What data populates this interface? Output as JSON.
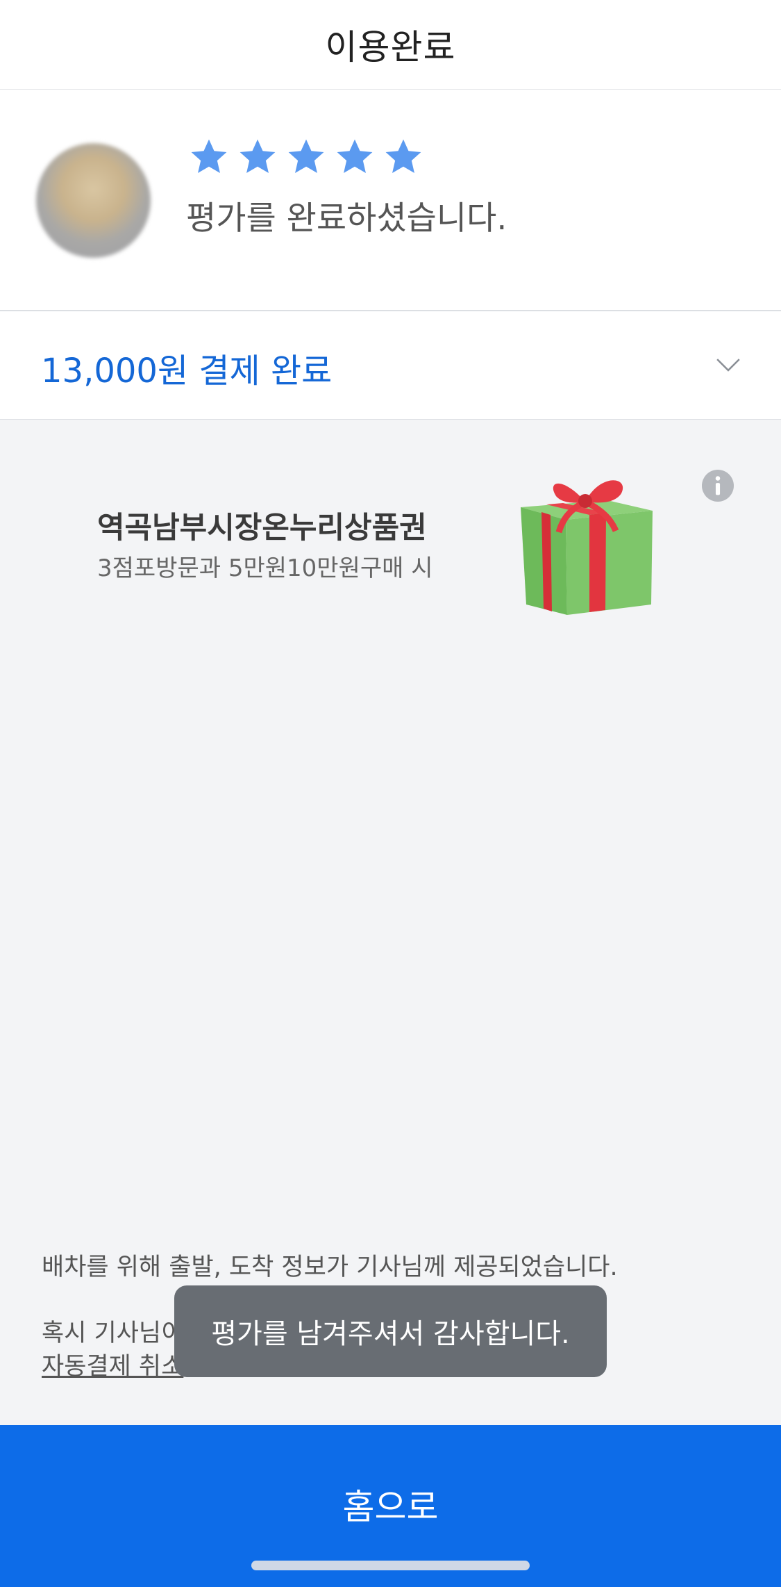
{
  "header": {
    "title": "이용완료"
  },
  "rating": {
    "stars": 5,
    "message": "평가를 완료하셨습니다."
  },
  "payment": {
    "summary": "13,000원 결제 완료"
  },
  "promo": {
    "title": "역곡남부시장온누리상품권",
    "subtitle": "3점포방문과 5만원10만원구매 시"
  },
  "notice": {
    "line1": "배차를 위해 출발, 도착 정보가 기사님께 제공되었습니다.",
    "line2": "혹시 기사님이",
    "link": "자동결제 취소"
  },
  "toast": {
    "message": "평가를 남겨주셔서 감사합니다."
  },
  "footer": {
    "home_label": "홈으로"
  },
  "colors": {
    "accent": "#0d6ce8",
    "link": "#1467d6",
    "star": "#5b9af0",
    "toast": "#686d73"
  }
}
